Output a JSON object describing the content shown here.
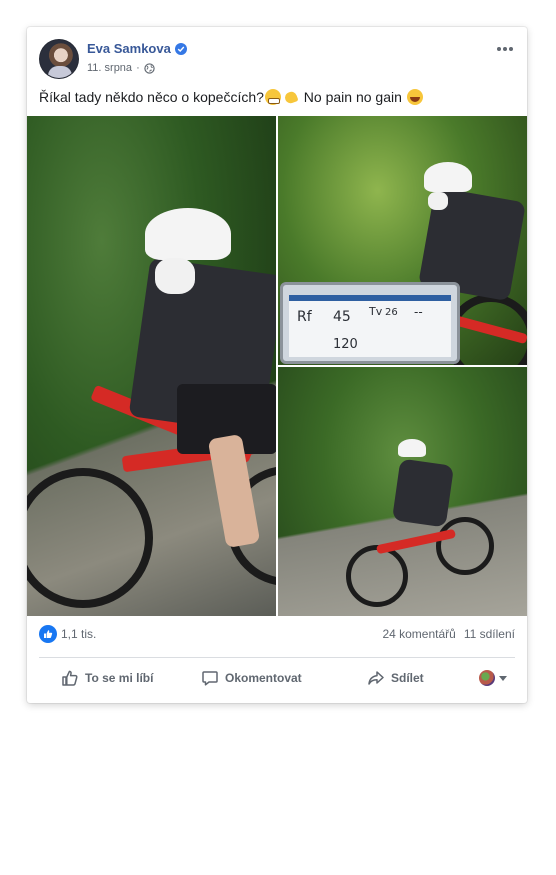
{
  "post": {
    "author": "Eva Samkova",
    "date": "11. srpna",
    "separator": "·",
    "text_before": "Říkal tady někdo něco o kopečcích?",
    "text_after": " No pain no gain ",
    "emojis": [
      "grimacing-face",
      "flexed-biceps",
      "laughing-face"
    ]
  },
  "photo_overlay": {
    "rf_label": "Rf",
    "rf_value": "45",
    "tv_label": "Tv",
    "tv_value": "26",
    "dashes": "--",
    "bottom_value": "120"
  },
  "stats": {
    "likes": "1,1 tis.",
    "comments": "24 komentářů",
    "shares": "11 sdílení"
  },
  "actions": {
    "like": "To se mi líbí",
    "comment": "Okomentovat",
    "share": "Sdílet"
  },
  "colors": {
    "author_link": "#385898",
    "like_blue": "#1877f2",
    "verified_blue": "#3578e5",
    "secondary_text": "#606770",
    "bike_red": "#d52a25"
  }
}
